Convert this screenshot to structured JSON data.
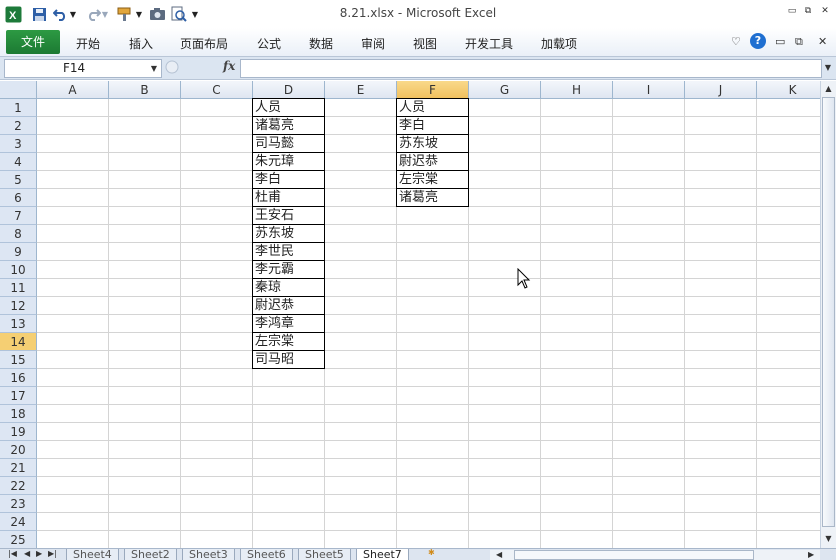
{
  "title_bar": {
    "title": "8.21.xlsx  -  Microsoft Excel",
    "icons": [
      "excel-logo-icon",
      "save-icon",
      "undo-icon",
      "redo-icon",
      "format-painter-icon",
      "camera-icon",
      "print-preview-icon",
      "customize-qat-icon"
    ]
  },
  "ribbon": {
    "file_tab": "文件",
    "tabs": [
      "开始",
      "插入",
      "页面布局",
      "公式",
      "数据",
      "审阅",
      "视图",
      "开发工具",
      "加载项"
    ]
  },
  "formula_bar": {
    "name_box": "F14",
    "fx_label": "fx",
    "formula": ""
  },
  "sheet": {
    "columns": [
      "A",
      "B",
      "C",
      "D",
      "E",
      "F",
      "G",
      "H",
      "I",
      "J",
      "K"
    ],
    "selected_column": "F",
    "rows": [
      "1",
      "2",
      "3",
      "4",
      "5",
      "6",
      "7",
      "8",
      "9",
      "10",
      "11",
      "12",
      "13",
      "14",
      "15",
      "16",
      "17",
      "18",
      "19",
      "20",
      "21",
      "22",
      "23",
      "24",
      "25"
    ],
    "selected_row": "14",
    "column_d": [
      "人员",
      "诸葛亮",
      "司马懿",
      "朱元璋",
      "李白",
      "杜甫",
      "王安石",
      "苏东坡",
      "李世民",
      "李元霸",
      "秦琼",
      "尉迟恭",
      "李鸿章",
      "左宗棠",
      "司马昭"
    ],
    "column_f": [
      "人员",
      "李白",
      "苏东坡",
      "尉迟恭",
      "左宗棠",
      "诸葛亮"
    ]
  },
  "sheet_tabs": {
    "tabs": [
      "Sheet4",
      "Sheet2",
      "Sheet3",
      "Sheet6",
      "Sheet5",
      "Sheet7"
    ],
    "active": "Sheet7"
  },
  "colors": {
    "file_tab": "#1c7a33",
    "header_bg": "#dde6f3",
    "selected_header": "#f5cf73",
    "gridline": "#d4d4d4"
  }
}
